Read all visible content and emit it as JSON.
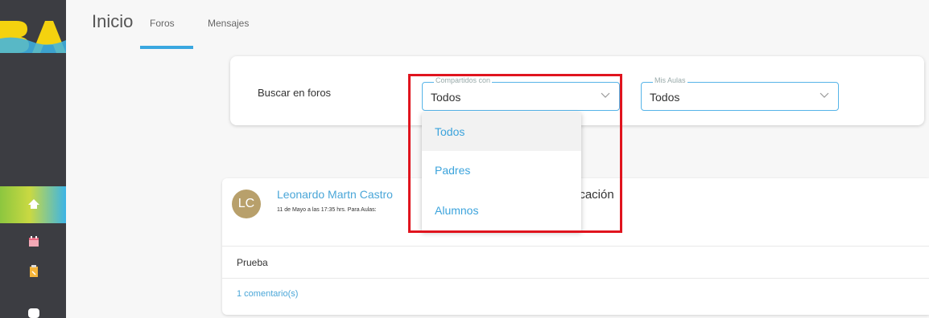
{
  "tabs": {
    "inicio": "Inicio",
    "foros": "Foros",
    "mensajes": "Mensajes"
  },
  "search": {
    "label": "Buscar en foros",
    "compartidos": {
      "legend": "Compartidos con",
      "value": "Todos"
    },
    "mis_aulas": {
      "legend": "Mis Aulas",
      "value": "Todos"
    }
  },
  "dropdown": {
    "options": [
      "Todos",
      "Padres",
      "Alumnos"
    ],
    "selected": "Todos"
  },
  "post": {
    "avatar_initials": "LC",
    "author": "Leonardo Martn Castro",
    "meta": "11 de Mayo a las 17:35 hrs. Para Aulas:",
    "title_partial": "icación",
    "body": "Prueba",
    "comments": "1 comentario(s)"
  },
  "colors": {
    "accent": "#3aa7e0",
    "highlight": "#e0141e",
    "sidebar": "#3c3d42"
  },
  "icons": [
    "logo",
    "home-icon",
    "calendar-icon",
    "clipboard-icon",
    "chat-icon",
    "chevron-down-icon"
  ]
}
